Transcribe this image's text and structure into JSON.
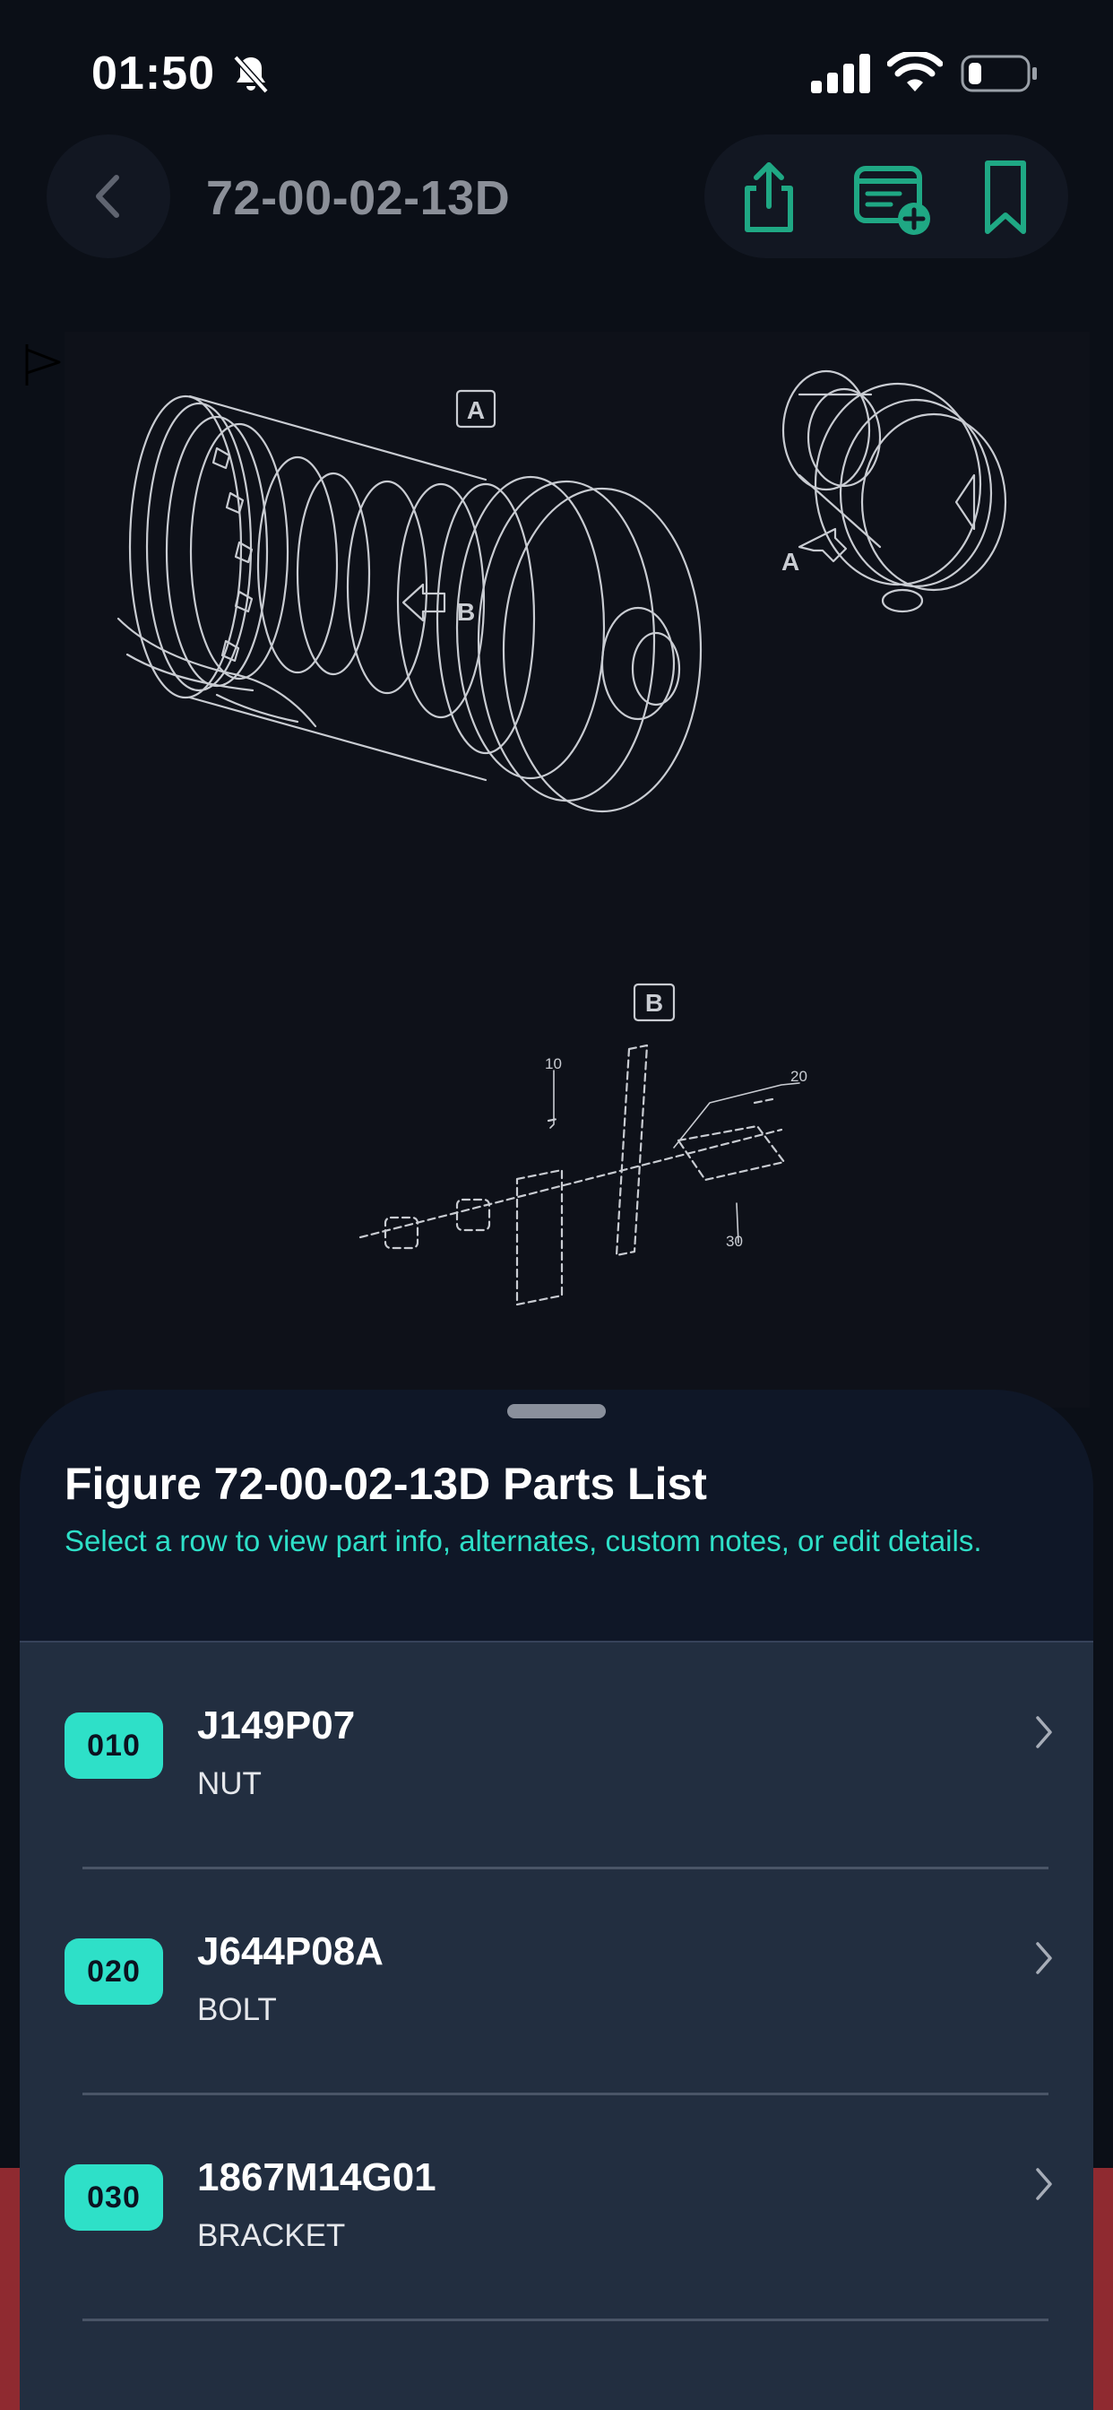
{
  "status_bar": {
    "time": "01:50",
    "icons": [
      "bell-slash-icon",
      "cellular-signal-icon",
      "wifi-icon",
      "battery-icon"
    ]
  },
  "header": {
    "title": "72-00-02-13D",
    "back_icon": "chevron-left-icon",
    "actions": [
      "share-icon",
      "add-note-icon",
      "bookmark-icon"
    ]
  },
  "diagram": {
    "callouts": {
      "view_a": "A",
      "view_b": "B",
      "arrow_a": "A",
      "arrow_b": "B"
    },
    "item_labels": [
      "10",
      "20",
      "30"
    ]
  },
  "sheet": {
    "title": "Figure 72-00-02-13D Parts List",
    "subtitle": "Select a row to view part info, alternates, custom notes, or edit details.",
    "rows": [
      {
        "item": "010",
        "part_number": "J149P07",
        "description": "NUT"
      },
      {
        "item": "020",
        "part_number": "J644P08A",
        "description": "BOLT"
      },
      {
        "item": "030",
        "part_number": "1867M14G01",
        "description": "BRACKET"
      }
    ]
  },
  "colors": {
    "accent": "#2EE0C8",
    "background": "#0B0F17",
    "sheet": "#0F1727",
    "list": "#222E40",
    "icon_green": "#1FA884"
  }
}
